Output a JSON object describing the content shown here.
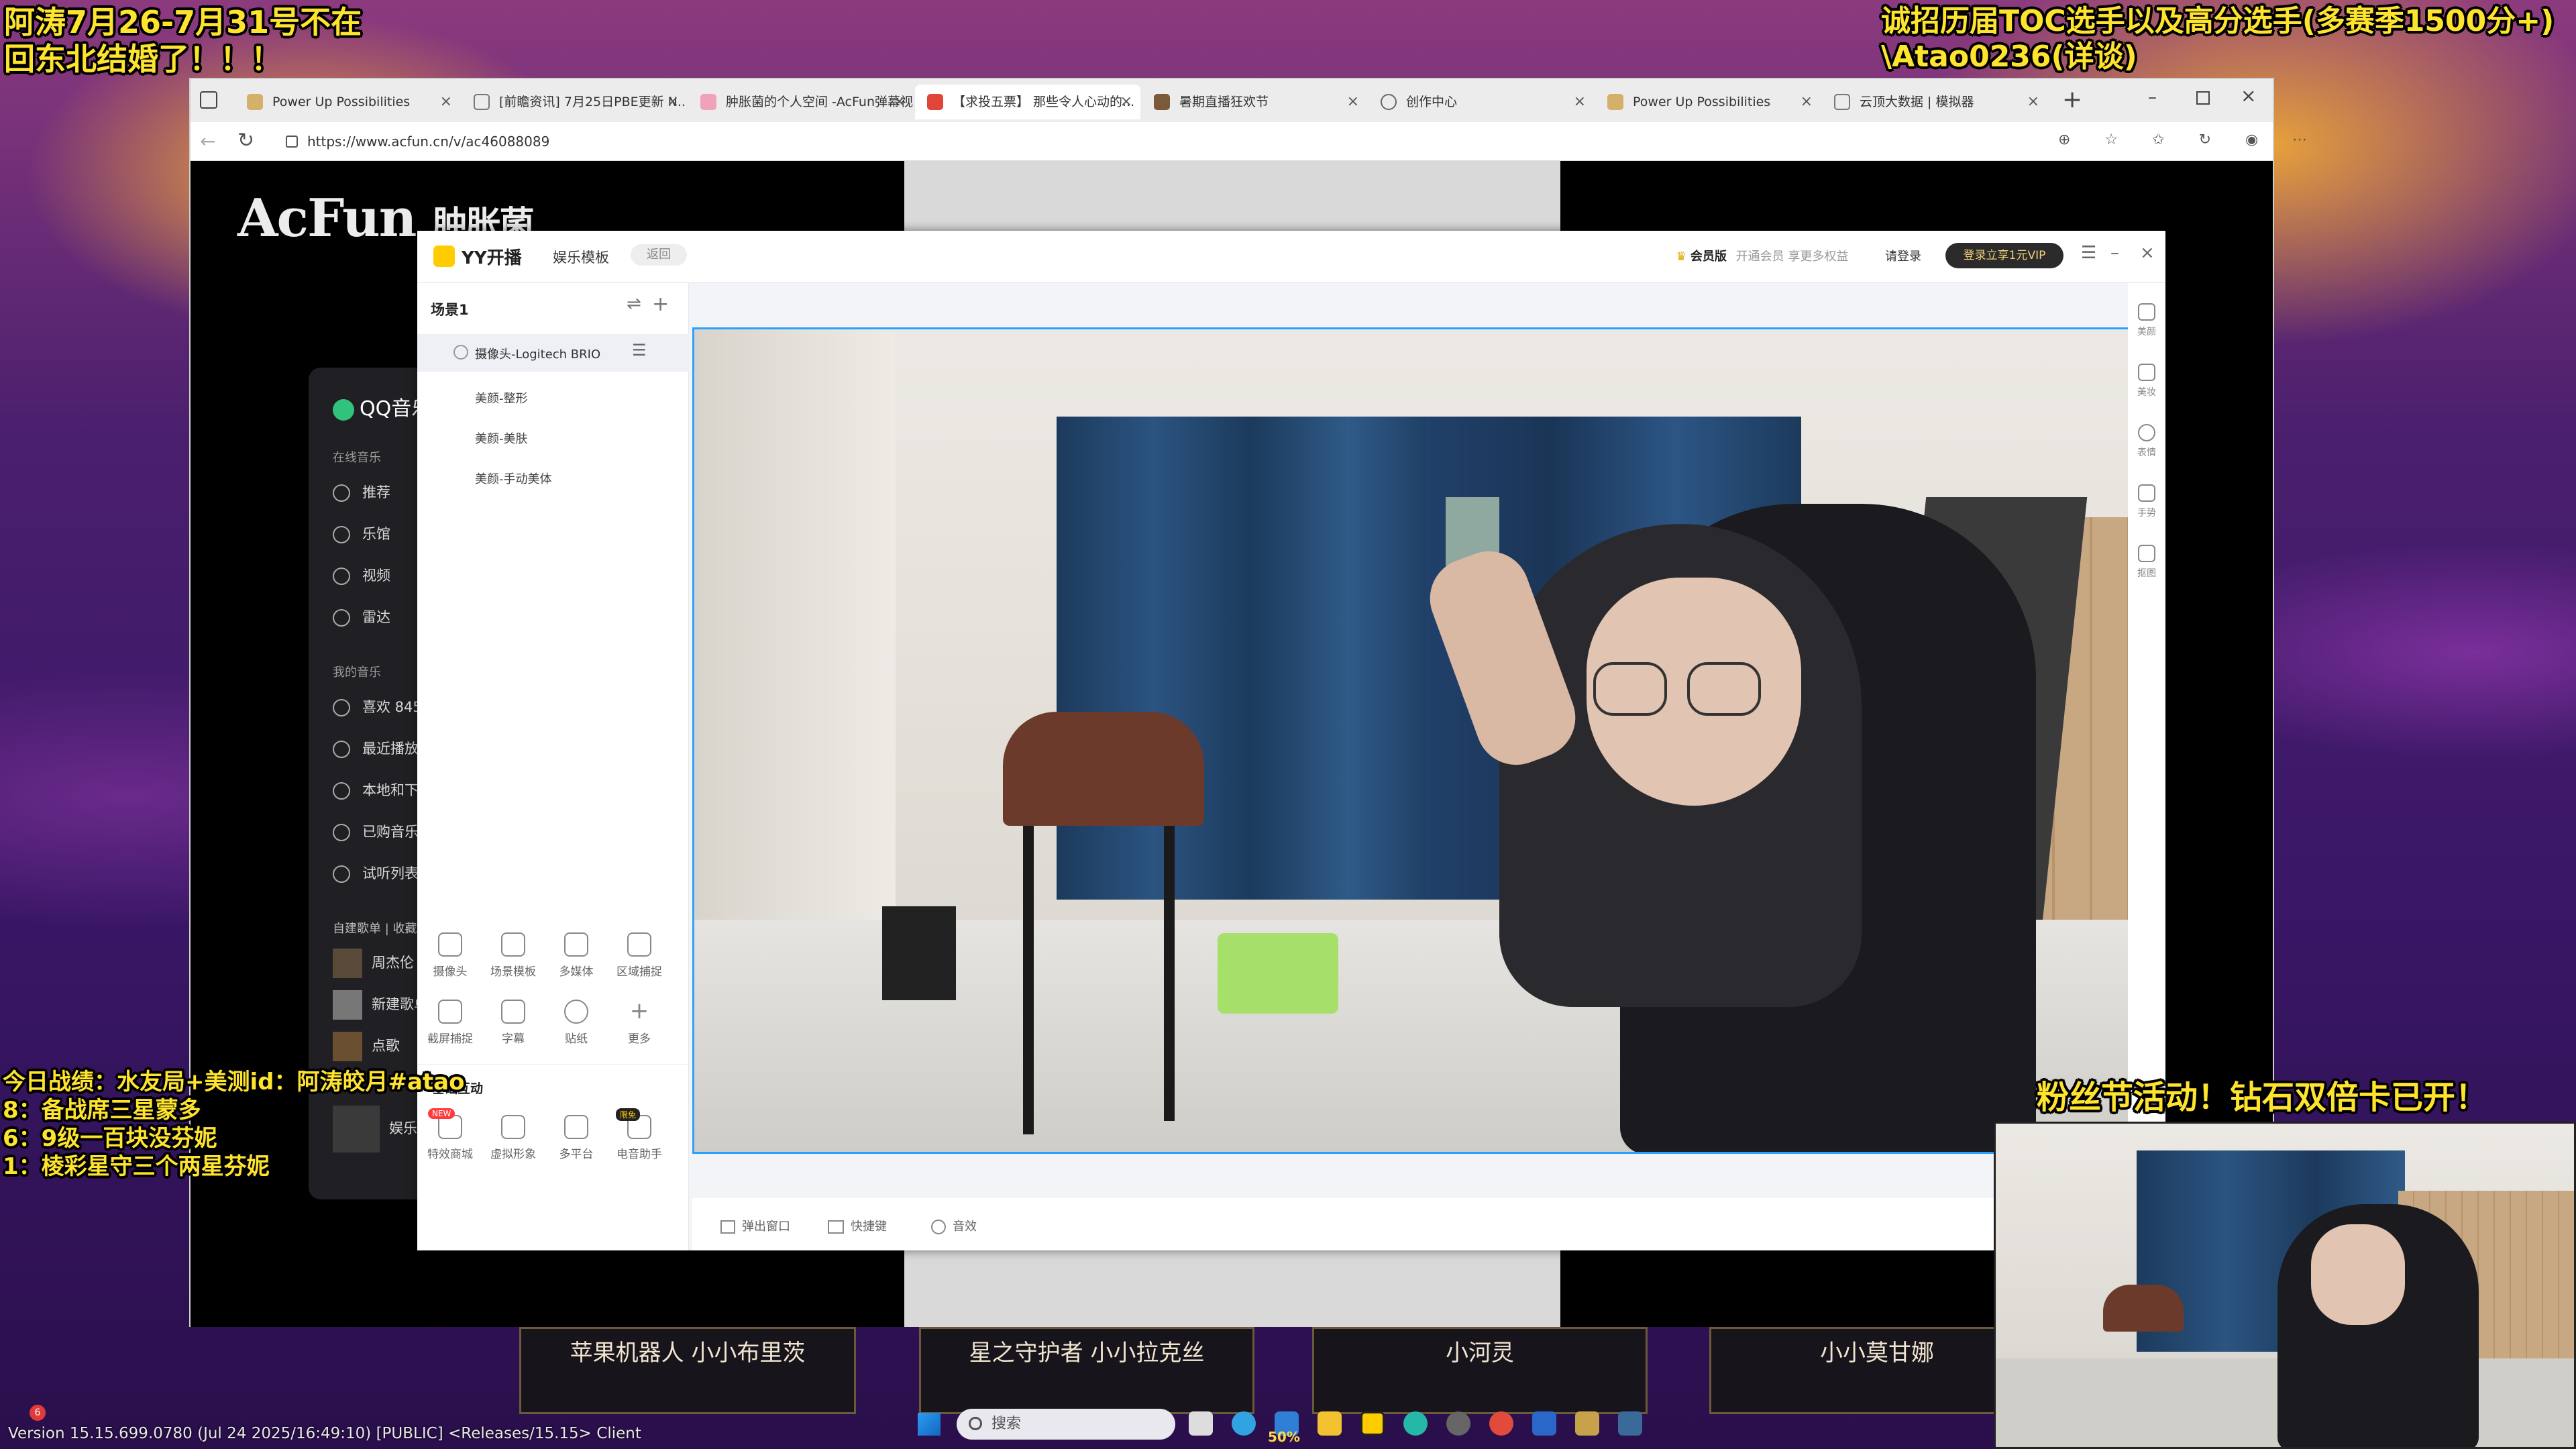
{
  "overlay": {
    "top_left": [
      "阿涛7月26-7月31号不在",
      "回东北结婚了！！！"
    ],
    "top_right": [
      "诚招历届TOC选手以及高分选手(多赛季1500分+)",
      "\\Atao0236(详谈)"
    ],
    "mid_left": [
      "今日战绩：水友局+美测id：阿涛皎月#atao",
      "8：备战席三星蒙多",
      "6：9级一百块没芬妮",
      "1：棱彩星守三个两星芬妮"
    ],
    "right_banner": "粉丝节活动！钻石双倍卡已开！",
    "version": "Version 15.15.699.0780 (Jul 24 2025/16:49:10) [PUBLIC] <Releases/15.15> Client"
  },
  "browser": {
    "tabs": [
      "Power Up Possibilities",
      "[前瞻资讯] 7月25日PBE更新 N...",
      "肿胀菌的个人空间 -AcFun弹幕视...",
      "【求投五票】 那些令人心动的...",
      "暑期直播狂欢节",
      "创作中心",
      "Power Up Possibilities",
      "云顶大数据 | 模拟器"
    ],
    "url": "https://www.acfun.cn/v/ac46088089",
    "new_tab": "+"
  },
  "acfun": {
    "logo": "AcFun",
    "logo_suffix": "肿胀菌"
  },
  "qq_music": {
    "title": "QQ音乐",
    "section_online": "在线音乐",
    "online_items": [
      "推荐",
      "乐馆",
      "视频",
      "雷达"
    ],
    "section_mine": "我的音乐",
    "mine_items": [
      "喜欢 845",
      "最近播放",
      "本地和下载",
      "已购音乐",
      "试听列表"
    ],
    "playlist_tabs": [
      "自建歌单",
      "收藏"
    ],
    "playlists": [
      "周杰伦",
      "新建歌单",
      "点歌"
    ],
    "now_playing": "娱乐大"
  },
  "yy": {
    "app_name": "YY开播",
    "mode": "娱乐模板",
    "back": "返回",
    "vip_label": "会员版",
    "vip_desc": "开通会员 享更多权益",
    "login": "请登录",
    "vip_promo": "登录立享1元VIP",
    "scene_name": "场景1",
    "source_camera": "摄像头-Logitech BRIO",
    "sub_sources": [
      "美颜-整形",
      "美颜-美肤",
      "美颜-手动美体"
    ],
    "tools_row1": [
      "摄像头",
      "场景模板",
      "多媒体",
      "区域捕捉"
    ],
    "tools_row2": [
      "截屏捕捉",
      "字幕",
      "贴纸",
      "更多"
    ],
    "interact_title": "基础互动",
    "interact_tools": [
      "特效商城",
      "虚拟形象",
      "多平台",
      "电音助手"
    ],
    "badge_new": "NEW",
    "badge_limit": "限免",
    "right_tools": [
      "美颜",
      "美妆",
      "表情",
      "手势",
      "抠图"
    ],
    "bottom_tools": [
      "弹出窗口",
      "快捷键",
      "音效"
    ]
  },
  "champions": [
    "苹果机器人 小小布里茨",
    "星之守护者 小小拉克丝",
    "小河灵",
    "小小莫甘娜"
  ],
  "taskbar": {
    "search": "搜索",
    "percent": "50%",
    "counter": "6"
  },
  "colors": {
    "accent": "#2aa0ff",
    "overlay_text": "#ffe42e",
    "yy_yellow": "#ffcc00"
  }
}
